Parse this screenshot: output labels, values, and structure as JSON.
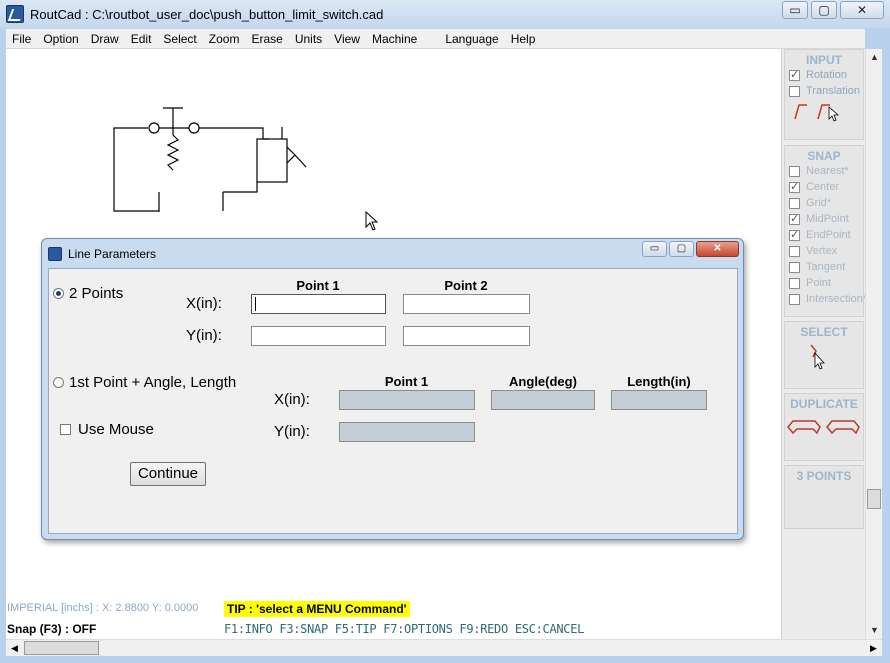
{
  "window": {
    "title": "RoutCad : C:\\routbot_user_doc\\push_button_limit_switch.cad",
    "controls": [
      "▭",
      "▢",
      "✕"
    ]
  },
  "menu": [
    "File",
    "Option",
    "Draw",
    "Edit",
    "Select",
    "Zoom",
    "Erase",
    "Units",
    "View",
    "Machine",
    "Language",
    "Help"
  ],
  "right_panel": {
    "input": {
      "title": "INPUT",
      "items": [
        {
          "label": "Rotation",
          "checked": true
        },
        {
          "label": "Translation",
          "checked": false
        }
      ]
    },
    "snap": {
      "title": "SNAP",
      "items": [
        {
          "label": "Nearest*",
          "checked": false
        },
        {
          "label": "Center",
          "checked": true
        },
        {
          "label": "Grid*",
          "checked": false
        },
        {
          "label": "MidPoint",
          "checked": true
        },
        {
          "label": "EndPoint",
          "checked": true
        },
        {
          "label": "Vertex",
          "checked": false
        },
        {
          "label": "Tangent",
          "checked": false
        },
        {
          "label": "Point",
          "checked": false
        },
        {
          "label": "Intersection*",
          "checked": false
        }
      ]
    },
    "select": {
      "title": "SELECT"
    },
    "duplicate": {
      "title": "DUPLICATE"
    },
    "three_points": {
      "title": "3 POINTS"
    }
  },
  "status": {
    "coords": "IMPERIAL [inchs] : X: 2.8800  Y: 0.0000",
    "snap": "Snap (F3) : OFF",
    "tip": "TIP : 'select a MENU Command'",
    "fkeys": "F1:INFO  F3:SNAP  F5:TIP  F7:OPTIONS  F9:REDO  ESC:CANCEL"
  },
  "dialog": {
    "title": "Line Parameters",
    "option1": "2 Points",
    "option2": "1st Point + Angle, Length",
    "use_mouse": "Use Mouse",
    "point1": "Point 1",
    "point2": "Point 2",
    "angle": "Angle(deg)",
    "length": "Length(in)",
    "x_label": "X(in):",
    "y_label": "Y(in):",
    "continue": "Continue",
    "selected_option": "2 Points",
    "use_mouse_checked": false,
    "fields": {
      "x1": "",
      "x2": "",
      "y1": "",
      "y2": "",
      "b_x": "",
      "b_angle": "",
      "b_length": "",
      "b_y": ""
    }
  },
  "colors": {
    "accent": "#2a5a9c",
    "tip_background": "#ffff00",
    "fkey_text": "#2e6a78",
    "drawing_red": "#c0392b"
  }
}
